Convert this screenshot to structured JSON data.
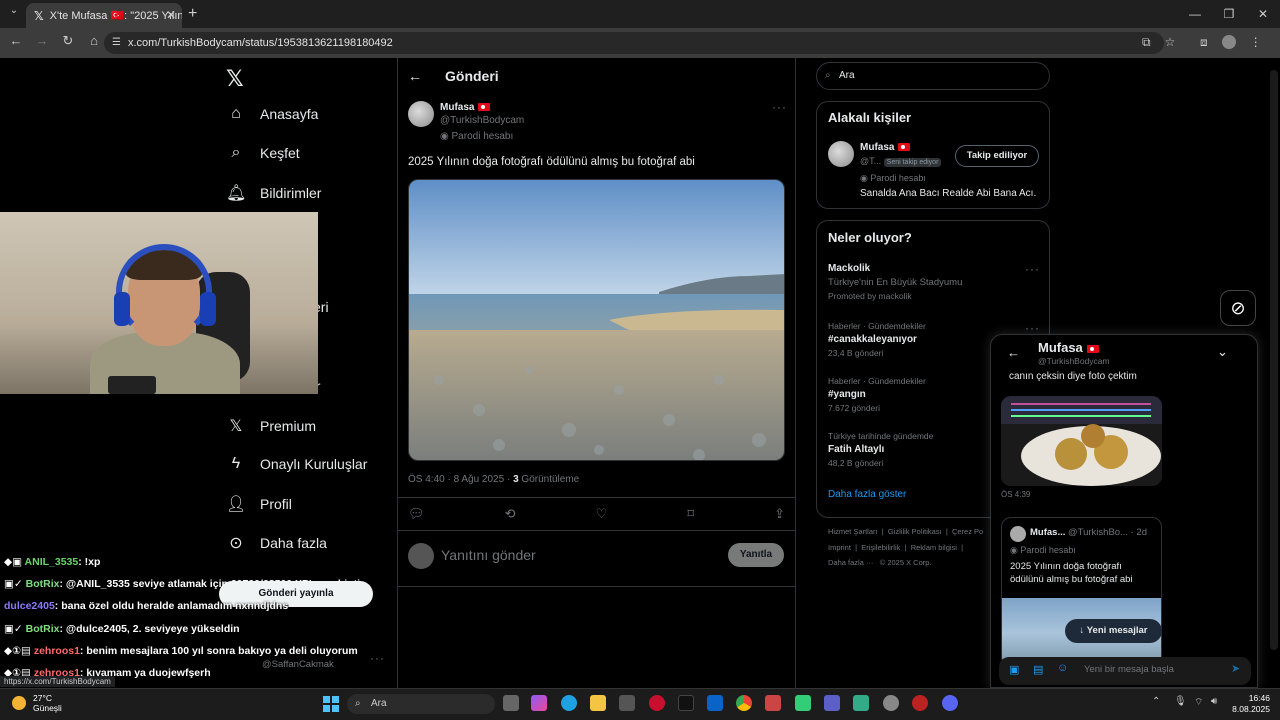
{
  "browser": {
    "tab_title": "X'te Mufasa 🇹🇷: \"2025 Yılının do...",
    "url": "x.com/TurkishBodycam/status/1953813621198180492",
    "status_url": "https://x.com/TurkishBodycam"
  },
  "sidebar": {
    "logo": "𝕏",
    "items": [
      {
        "label": "Anasayfa"
      },
      {
        "label": "Keşfet"
      },
      {
        "label": "Bildirimler"
      },
      {
        "label": "eri"
      },
      {
        "label": "ar"
      },
      {
        "label": "Premium"
      },
      {
        "label": "Onaylı Kuruluşlar"
      },
      {
        "label": "Profil"
      },
      {
        "label": "Daha fazla"
      }
    ],
    "post_button": "Gönderi yayınla",
    "account_handle": "@SaffanCakmak"
  },
  "post": {
    "header_title": "Gönderi",
    "author_name": "Mufasa",
    "author_handle": "@TurkishBodycam",
    "parody_label": "Parodi hesabı",
    "text": "2025 Yılının doğa fotoğrafı ödülünü almış bu fotoğraf abi",
    "time": "ÖS 4:40 · 8 Ağu 2025 · ",
    "views_count": "3",
    "views_label": " Görüntüleme",
    "reply_placeholder": "Yanıtını gönder",
    "reply_button": "Yanıtla"
  },
  "right": {
    "search_placeholder": "Ara",
    "related_title": "Alakalı kişiler",
    "related_name": "Mufasa",
    "related_handle": "@T...",
    "follows_you": "Seni takip ediyor",
    "following_button": "Takip ediliyor",
    "related_parody": "Parodi hesabı",
    "related_bio": "Sanalda Ana Bacı Realde Abi Bana Acı.",
    "trends_title": "Neler oluyor?",
    "trends": [
      {
        "meta": "",
        "name": "Mackolik",
        "desc": "Türkiye'nin En Büyük Stadyumu",
        "extra": "Promoted by mackolik"
      },
      {
        "meta": "Haberler · Gündemdekiler",
        "name": "#canakkaleyanıyor",
        "desc": "",
        "extra": "23,4 B gönderi"
      },
      {
        "meta": "Haberler · Gündemdekiler",
        "name": "#yangın",
        "desc": "",
        "extra": "7.672 gönderi"
      },
      {
        "meta": "Türkiye tarihinde gündemde",
        "name": "Fatih Altaylı",
        "desc": "",
        "extra": "48,2 B gönderi"
      }
    ],
    "show_more": "Daha fazla göster",
    "footer": [
      "Hizmet Şartları",
      "Gizlilik Politikası",
      "Çerez Po",
      "Imprint",
      "Erişilebilirlik",
      "Reklam bilgisi",
      "Daha fazla ···",
      "© 2025 X Corp."
    ]
  },
  "dm": {
    "name": "Mufasa",
    "handle": "@TurkishBodycam",
    "msg1": "canın çeksin diye foto çektim",
    "msg1_time": "ÖS 4:39",
    "quote_name": "Mufas...",
    "quote_handle": "@TurkishBo... · 2d",
    "quote_parody": "Parodi hesabı",
    "quote_text": "2025 Yılının doğa fotoğrafı ödülünü almış bu fotoğraf abi",
    "new_messages": "↓ Yeni mesajlar",
    "input_placeholder": "Yeni bir mesaja başla"
  },
  "chat": [
    {
      "user": "ANIL_3535",
      "msg": ": !xp"
    },
    {
      "user": "BotRix",
      "msg": ": @ANIL_3535 seviye atlamak için 60700/62500 XP'ye sahiptir."
    },
    {
      "user": "dulce2405",
      "msg": ": bana özel oldu heralde anlamadım nxnndjdns"
    },
    {
      "user": "BotRix",
      "msg": ": @dulce2405, 2. seviyeye yükseldin"
    },
    {
      "user": "zehroos1",
      "msg": ": benim mesajlara 100 yıl sonra bakıyo ya deli oluyorum"
    },
    {
      "user": "zehroos1",
      "msg": ": kıyamam ya duojewfşerh"
    }
  ],
  "taskbar": {
    "weather_temp": "27°C",
    "weather_desc": "Güneşli",
    "search": "Ara",
    "time": "16:46",
    "date": "8.08.2025"
  },
  "colors": {
    "accent": "#1d9bf0",
    "border": "#2f3336",
    "muted": "#71767b"
  }
}
